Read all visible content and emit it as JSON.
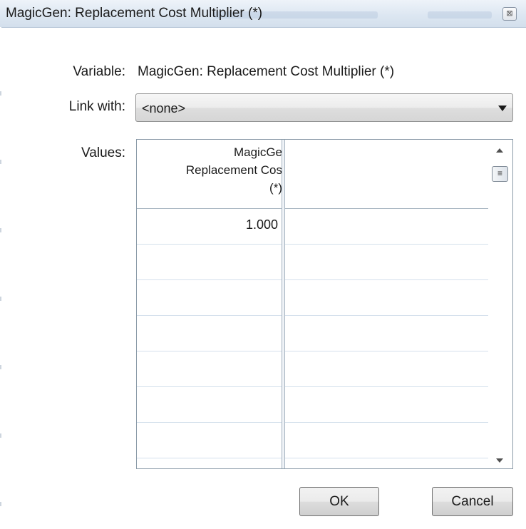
{
  "window": {
    "title": "MagicGen: Replacement Cost Multiplier (*)",
    "close_glyph": "⊠"
  },
  "form": {
    "variable_label": "Variable:",
    "variable_value": "MagicGen: Replacement Cost Multiplier (*)",
    "link_label": "Link with:",
    "link_value": "<none>",
    "values_label": "Values:"
  },
  "grid": {
    "column_header_lines": [
      "MagicGe",
      "Replacement Cos",
      "(*)"
    ],
    "rows": [
      "1.000",
      "",
      "",
      "",
      "",
      "",
      "",
      ""
    ]
  },
  "scrollbar": {
    "thumb_glyph": "≡"
  },
  "buttons": {
    "ok_label": "OK",
    "cancel_label": "Cancel"
  },
  "icons": {
    "close": "close-icon",
    "dropdown": "chevron-down-icon",
    "scroll_up": "arrow-up-icon",
    "scroll_down": "arrow-down-icon",
    "scroll_thumb": "grip-icon"
  }
}
